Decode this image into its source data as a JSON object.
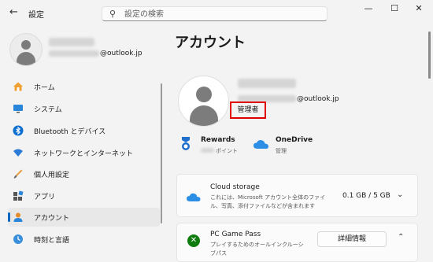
{
  "window": {
    "app_title": "設定",
    "back_glyph": "←",
    "minimize_glyph": "—",
    "maximize_glyph": "☐",
    "close_glyph": "✕"
  },
  "search": {
    "placeholder": "設定の検索"
  },
  "profile": {
    "email_suffix": "@outlook.jp"
  },
  "sidebar": {
    "items": [
      {
        "label": "ホーム",
        "icon": "home-icon"
      },
      {
        "label": "システム",
        "icon": "system-icon"
      },
      {
        "label": "Bluetooth とデバイス",
        "icon": "bluetooth-icon"
      },
      {
        "label": "ネットワークとインターネット",
        "icon": "network-icon"
      },
      {
        "label": "個人用設定",
        "icon": "personalization-icon"
      },
      {
        "label": "アプリ",
        "icon": "apps-icon"
      },
      {
        "label": "アカウント",
        "icon": "account-icon",
        "active": true
      },
      {
        "label": "時刻と言語",
        "icon": "time-language-icon"
      }
    ]
  },
  "main": {
    "title": "アカウント",
    "email_suffix": "@outlook.jp",
    "role_badge": "管理者",
    "rewards": {
      "label": "Rewards",
      "sub": "ポイント"
    },
    "onedrive": {
      "label": "OneDrive",
      "sub": "管理"
    },
    "cloud_storage": {
      "title": "Cloud storage",
      "description": "これには、Microsoft アカウント全体のファイル、写真、添付ファイルなどが含まれます",
      "value": "0.1 GB / 5 GB"
    },
    "game_pass": {
      "title": "PC Game Pass",
      "description": "プレイするためのオールインクルーシブパス",
      "button_label": "詳細情報"
    }
  },
  "colors": {
    "accent": "#0067c0",
    "highlight_border": "#e00000",
    "xbox_green": "#107c10"
  }
}
